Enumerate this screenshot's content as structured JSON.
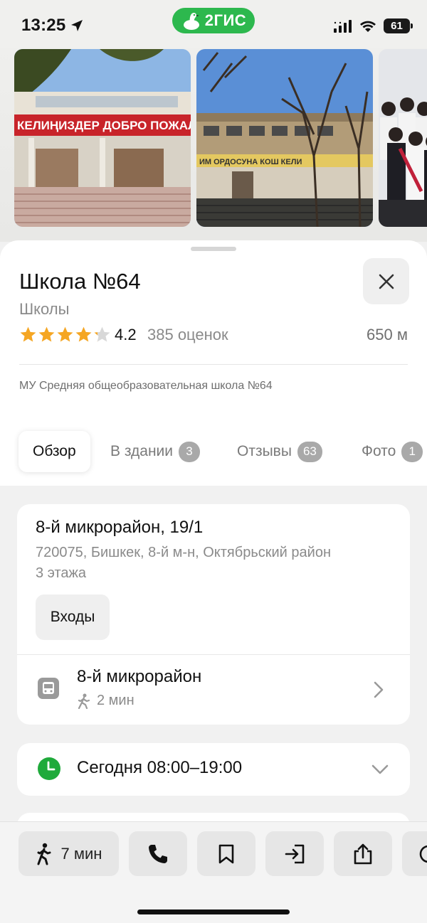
{
  "status_bar": {
    "time": "13:25",
    "brand": "2ГИС",
    "battery": "61"
  },
  "place": {
    "title": "Школа №64",
    "category": "Школы",
    "rating": "4.2",
    "rating_stars": 4.2,
    "rating_count": "385 оценок",
    "distance": "650 м",
    "full_name": "МУ Средняя общеобразовательная школа №64"
  },
  "photos": {
    "photo1_sign": "КЕЛИҢИЗДЕР ДОБРО ПОЖАЛ",
    "photo2_sign": "ИМ ОРДОСУНА КОШ КЕЛИ"
  },
  "tabs": [
    {
      "label": "Обзор",
      "badge": ""
    },
    {
      "label": "В здании",
      "badge": "3"
    },
    {
      "label": "Отзывы",
      "badge": "63"
    },
    {
      "label": "Фото",
      "badge": "1"
    }
  ],
  "address": {
    "main": "8-й микрорайон, 19/1",
    "details": "720075, Бишкек, 8-й м-н, Октябрьский район",
    "floors": "3 этажа",
    "entries_button": "Входы"
  },
  "transit": {
    "stop": "8-й микрорайон",
    "walk_time": "2 мин"
  },
  "hours": {
    "text": "Сегодня 08:00–19:00"
  },
  "actions": {
    "route_time": "7 мин"
  },
  "colors": {
    "brand_green": "#2db84e",
    "star": "#f5a623",
    "open_green": "#1faa3b"
  },
  "icons": [
    "location-arrow-icon",
    "signal-icon",
    "wifi-icon",
    "close-icon",
    "star-icon",
    "bus-icon",
    "walk-icon",
    "chevron-right-icon",
    "clock-icon",
    "chevron-down-icon",
    "phone-icon",
    "bookmark-icon",
    "enter-icon",
    "share-icon"
  ]
}
